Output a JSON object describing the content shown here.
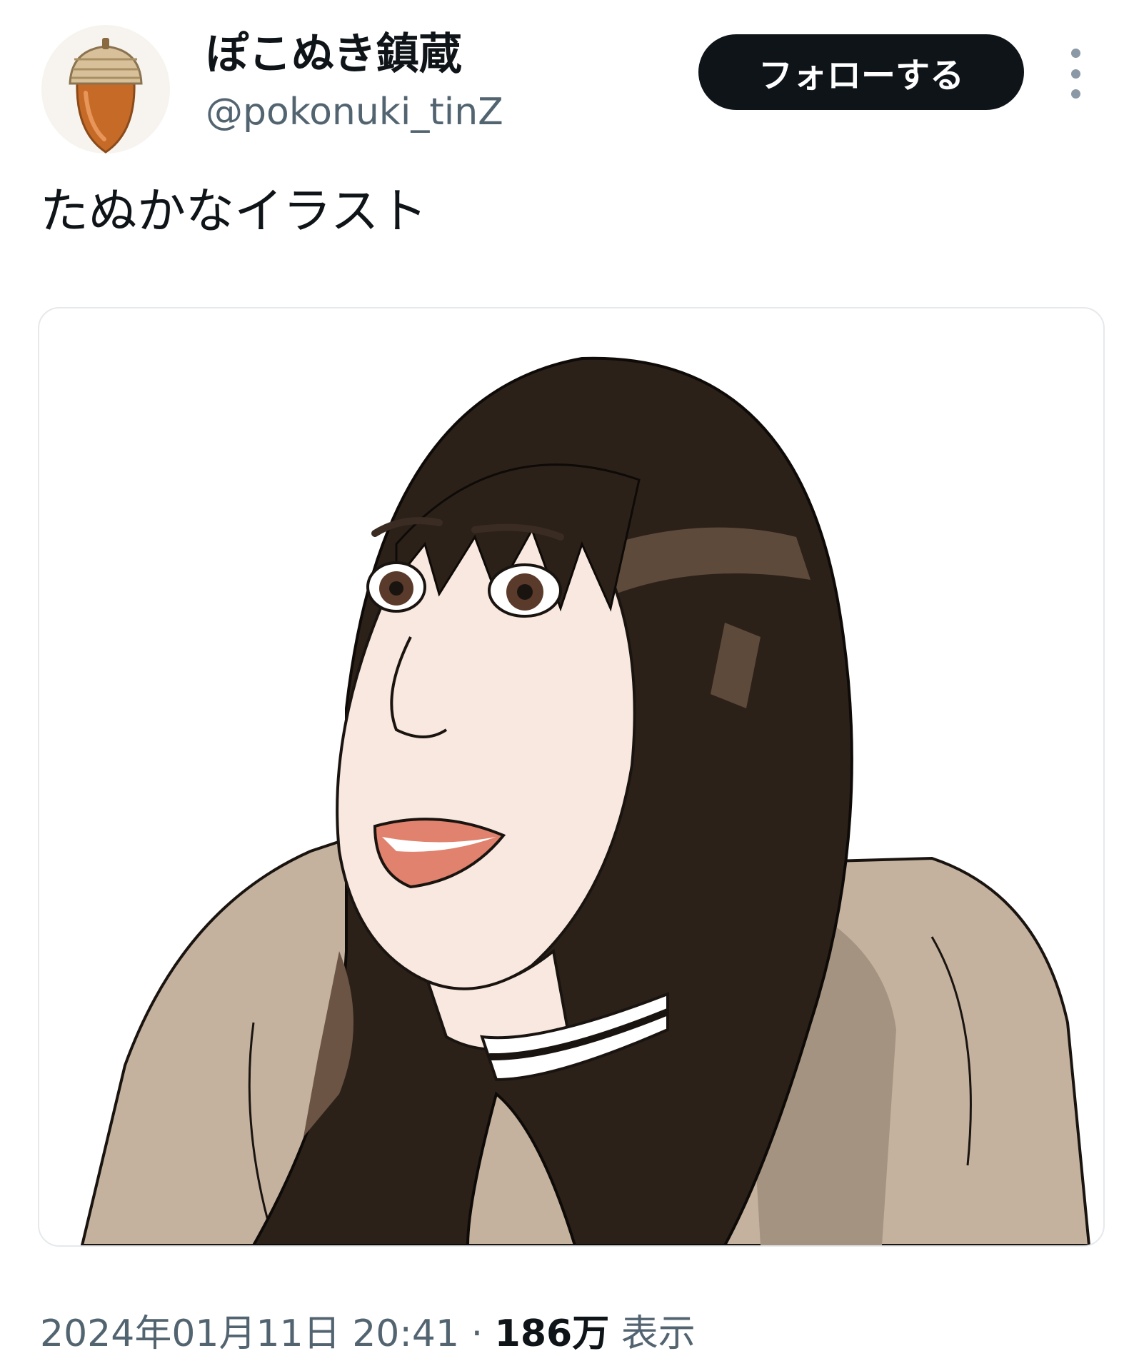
{
  "tweet": {
    "display_name": "ぽこぬき鎮蔵",
    "handle": "@pokonuki_tinZ",
    "follow_label": "フォローする",
    "text": "たぬかなイラスト",
    "timestamp": "2024年01月11日 20:41",
    "separator": "·",
    "views_count": "186万",
    "views_label": "表示"
  },
  "icons": {
    "avatar": "acorn-avatar-icon",
    "more": "more-vertical-icon"
  },
  "colors": {
    "follow_button_bg": "#0f1419",
    "secondary_text": "#536471",
    "hair": "#2b2119",
    "hoodie": "#c4b29f",
    "skin": "#f8e8df",
    "lips": "#e0826d"
  }
}
